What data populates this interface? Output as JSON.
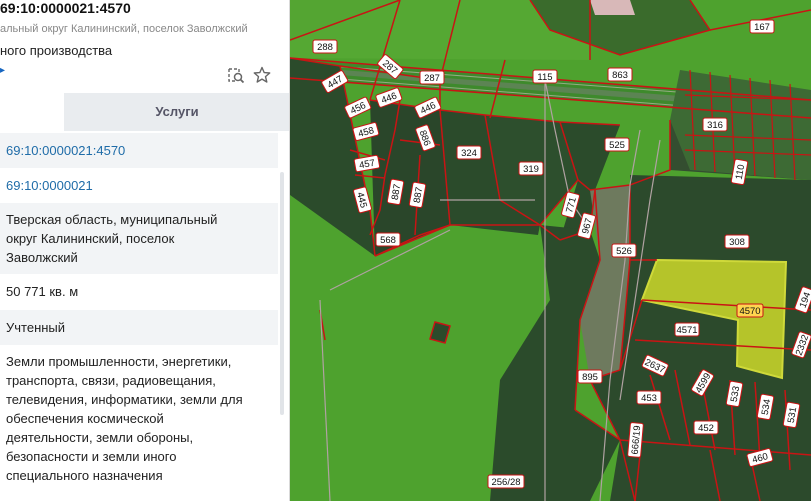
{
  "panel": {
    "title": "69:10:0000021:4570",
    "address_short": "альный округ Калининский, поселок Заволжский",
    "type_short": "ного производства",
    "icons": {
      "zoom": "map-search-icon",
      "favorite": "star-icon",
      "nav": "arrow-icon"
    },
    "tabs": {
      "left_label": "",
      "services_label": "Услуги"
    },
    "rows": {
      "cad_number": "69:10:0000021:4570",
      "quarter": "69:10:0000021",
      "address_lines": [
        "Тверская область, муниципальный",
        "округ Калининский, поселок",
        "Заволжский"
      ],
      "area": "50 771 кв. м",
      "status": "Учтенный",
      "category_lines": [
        "Земли промышленности, энергетики,",
        "транспорта, связи, радиовещания,",
        "телевидения, информатики, земли для",
        "обеспечения космической",
        "деятельности, земли обороны,",
        "безопасности и земли иного",
        "специального назначения"
      ]
    }
  },
  "map": {
    "colors": {
      "field": "#4ea22e",
      "forest": "#2b4b2b",
      "highlight": "#b5c42a",
      "border": "#c91414",
      "road": "#b0a2a2"
    },
    "parcel_labels": [
      "288",
      "287",
      "447",
      "287",
      "115",
      "863",
      "167",
      "446",
      "456",
      "446",
      "458",
      "886",
      "324",
      "319",
      "316",
      "525",
      "457",
      "887",
      "887",
      "445",
      "771",
      "967",
      "110",
      "568",
      "526",
      "308",
      "4570",
      "194",
      "4571",
      "895",
      "2332",
      "2637",
      "4599",
      "453",
      "533",
      "534",
      "531",
      "452",
      "666/19",
      "460",
      "256/28"
    ]
  }
}
